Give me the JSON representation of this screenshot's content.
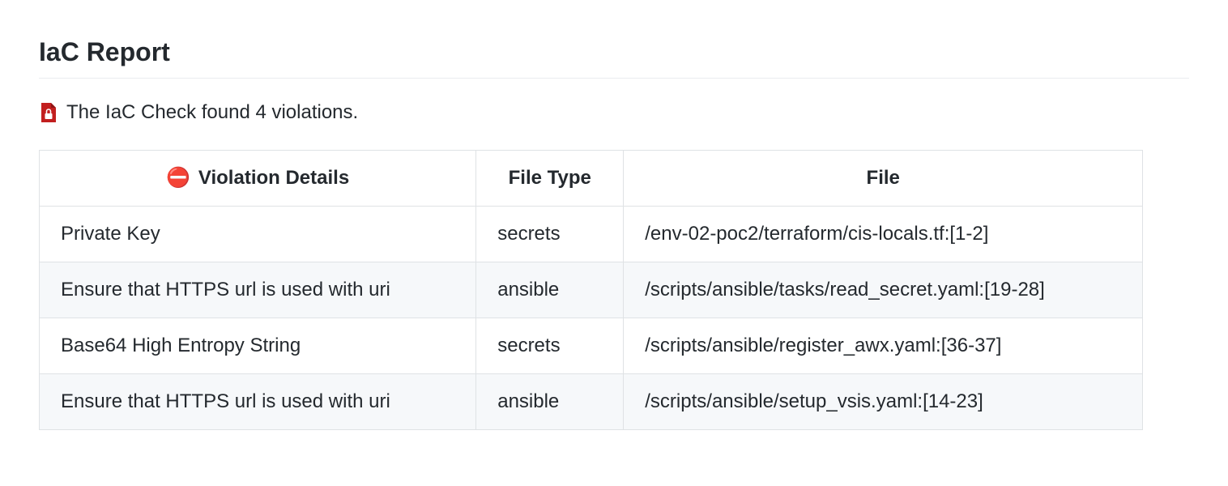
{
  "title": "IaC Report",
  "summary": "The IaC Check found 4 violations.",
  "columns": {
    "details": "Violation Details",
    "file_type": "File Type",
    "file": "File"
  },
  "rows": [
    {
      "details": "Private Key",
      "file_type": "secrets",
      "file": "/env-02-poc2/terraform/cis-locals.tf:[1-2]"
    },
    {
      "details": "Ensure that HTTPS url is used with uri",
      "file_type": "ansible",
      "file": "/scripts/ansible/tasks/read_secret.yaml:[19-28]"
    },
    {
      "details": "Base64 High Entropy String",
      "file_type": "secrets",
      "file": "/scripts/ansible/register_awx.yaml:[36-37]"
    },
    {
      "details": "Ensure that HTTPS url is used with uri",
      "file_type": "ansible",
      "file": "/scripts/ansible/setup_vsis.yaml:[14-23]"
    }
  ]
}
